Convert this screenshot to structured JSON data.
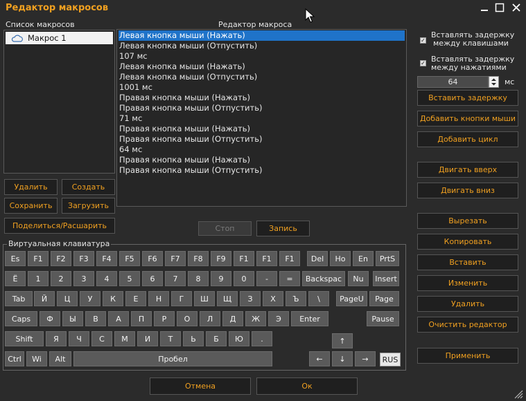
{
  "window": {
    "title": "Редактор макросов"
  },
  "colors": {
    "accent": "#f0a020",
    "selection": "#1f73c9",
    "background": "#2b2b2b"
  },
  "icons": {
    "minimize": "minimize-icon",
    "maximize": "maximize-icon",
    "close": "close-icon",
    "macro": "cloud-icon"
  },
  "macro_list": {
    "label": "Список макросов",
    "items": [
      {
        "label": "Макрос 1"
      }
    ],
    "buttons": {
      "delete": "Удалить",
      "create": "Создать",
      "save": "Сохранить",
      "load": "Загрузить",
      "share": "Поделиться/Расшарить"
    }
  },
  "editor": {
    "label": "Редактор макроса",
    "lines": [
      "Левая кнопка мыши (Нажать)",
      "Левая кнопка мыши (Отпустить)",
      "107 мс",
      "Левая кнопка мыши (Нажать)",
      "Левая кнопка мыши (Отпустить)",
      "1001 мс",
      "Правая кнопка мыши (Нажать)",
      "Правая кнопка мыши (Отпустить)",
      "71 мс",
      "Правая кнопка мыши (Нажать)",
      "Правая кнопка мыши (Отпустить)",
      "64 мс",
      "Правая кнопка мыши (Нажать)",
      "Правая кнопка мыши (Отпустить)"
    ],
    "selected_index": 0,
    "stop": "Стоп",
    "record": "Запись"
  },
  "options": {
    "delay_keys": {
      "line1": "Вставлять задержку",
      "line2": "между клавишами",
      "checked": true
    },
    "delay_clicks": {
      "line1": "Вставлять задержку",
      "line2": "между нажатиями",
      "checked": true
    },
    "delay_value": "64",
    "unit": "мс",
    "buttons": {
      "insert_delay": "Вставить задержку",
      "add_mouse": "Добавить кнопки мыши",
      "add_loop": "Добавить цикл",
      "move_up": "Двигать вверх",
      "move_down": "Двигать вниз",
      "cut": "Вырезать",
      "copy": "Копировать",
      "paste": "Вставить",
      "modify": "Изменить",
      "delete": "Удалить",
      "clear": "Очистить редактор",
      "apply": "Применить"
    }
  },
  "keyboard": {
    "label": "Виртуальная клавиатура",
    "keys": {
      "esc": "Es",
      "f1": "F1",
      "f2": "F2",
      "f3": "F3",
      "f4": "F4",
      "f5": "F5",
      "f6": "F6",
      "f7": "F7",
      "f8": "F8",
      "f9": "F9",
      "f10": "F1",
      "f11": "F1",
      "f12": "F1",
      "del": "Del",
      "home": "Ho",
      "end": "En",
      "prtsc": "PrtS",
      "yo": "Ё",
      "n1": "1",
      "n2": "2",
      "n3": "3",
      "n4": "4",
      "n5": "5",
      "n6": "6",
      "n7": "7",
      "n8": "8",
      "n9": "9",
      "n0": "0",
      "minus": "-",
      "equals": "=",
      "backspace": "Backspac",
      "numlock": "Nu",
      "insert": "Insert",
      "tab": "Tab",
      "y": "Й",
      "ts": "Ц",
      "u": "У",
      "k": "К",
      "ye": "Е",
      "n": "Н",
      "g": "Г",
      "sh": "Ш",
      "shch": "Щ",
      "z": "З",
      "kh": "Х",
      "hard": "Ъ",
      "backslash": "\\",
      "pageup": "PageU",
      "page": "Page",
      "caps": "Caps",
      "f": "Ф",
      "yy": "Ы",
      "v": "В",
      "a": "А",
      "p": "П",
      "r": "Р",
      "o": "О",
      "l": "Л",
      "d": "Д",
      "zh": "Ж",
      "e": "Э",
      "enter": "Enter",
      "pause": "Pause",
      "shift": "Shift",
      "ya": "Я",
      "ch": "Ч",
      "s": "С",
      "m": "М",
      "i": "И",
      "t": "Т",
      "soft": "Ь",
      "b": "Б",
      "yu": "Ю",
      "period": ".",
      "up": "↑",
      "ctrl": "Ctrl",
      "win": "Wi",
      "alt": "Alt",
      "space": "Пробел",
      "left": "←",
      "down": "↓",
      "right": "→",
      "rus": "RUS"
    }
  },
  "footer": {
    "cancel": "Отмена",
    "ok": "Ок"
  }
}
